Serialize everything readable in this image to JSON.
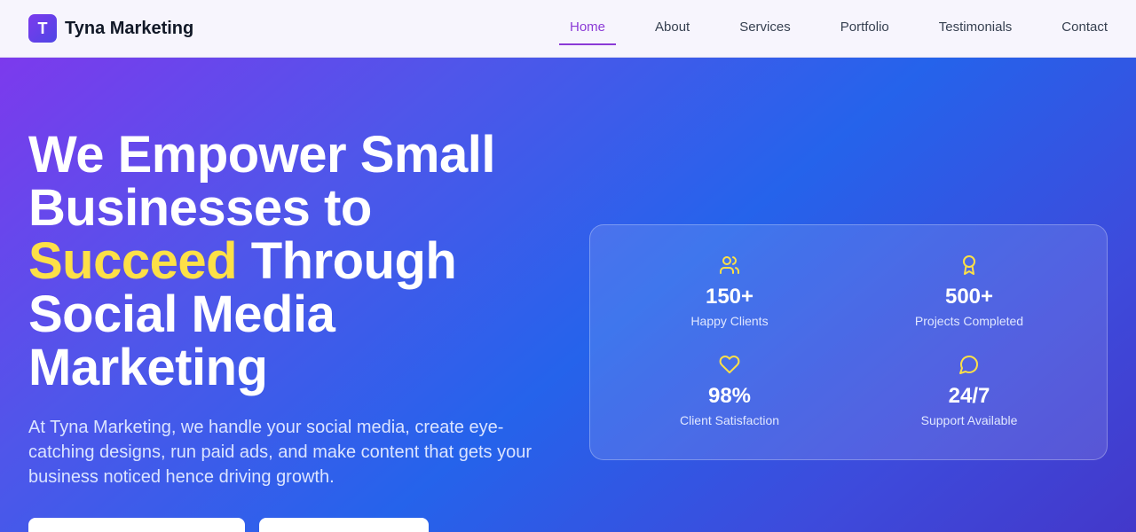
{
  "brand": {
    "logo_letter": "T",
    "name": "Tyna Marketing"
  },
  "nav": {
    "items": [
      {
        "label": "Home",
        "active": true
      },
      {
        "label": "About"
      },
      {
        "label": "Services"
      },
      {
        "label": "Portfolio"
      },
      {
        "label": "Testimonials"
      },
      {
        "label": "Contact"
      }
    ]
  },
  "hero": {
    "headline_part1": "We Empower Small Businesses to",
    "headline_accent": "Succeed",
    "headline_part2": "Through Social Media Marketing",
    "subtext": "At Tyna Marketing, we handle your social media, create eye-catching designs, run paid ads, and make content that gets your business noticed hence driving growth."
  },
  "stats": [
    {
      "icon": "users-icon",
      "value": "150+",
      "label": "Happy Clients"
    },
    {
      "icon": "award-icon",
      "value": "500+",
      "label": "Projects Completed"
    },
    {
      "icon": "heart-icon",
      "value": "98%",
      "label": "Client Satisfaction"
    },
    {
      "icon": "message-circle-icon",
      "value": "24/7",
      "label": "Support Available"
    }
  ],
  "colors": {
    "accent_yellow": "#fde047",
    "nav_active": "#8b3ad6",
    "gradient_start": "#7c3aed",
    "gradient_mid": "#2563eb",
    "gradient_end": "#4338ca"
  }
}
